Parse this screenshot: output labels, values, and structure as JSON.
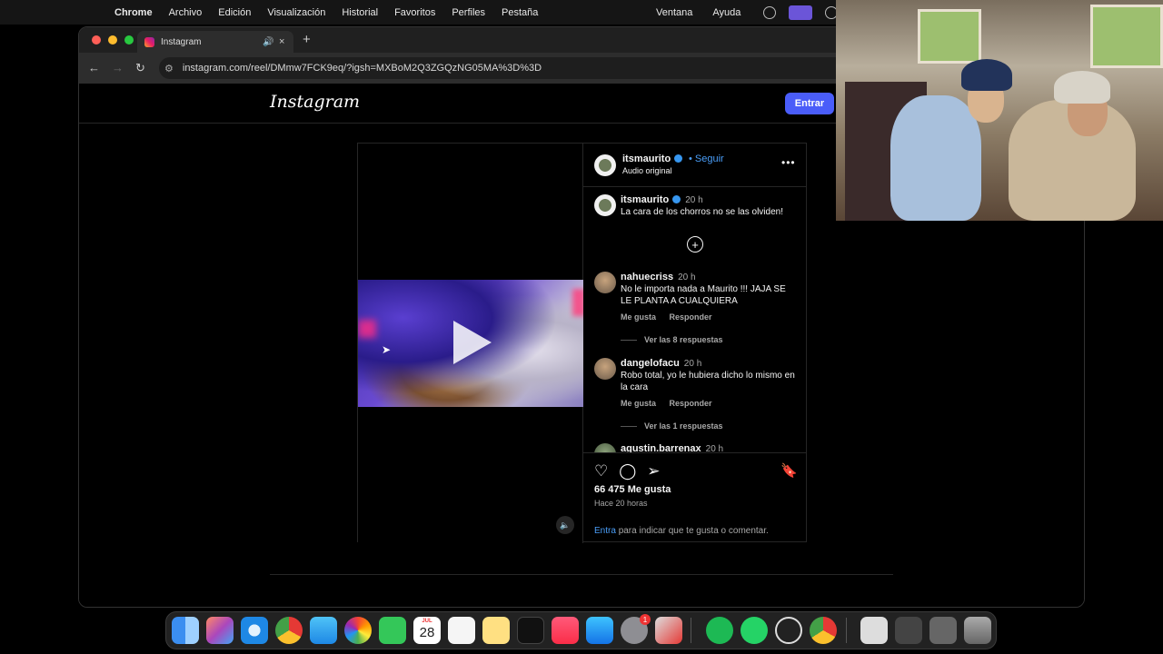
{
  "menubar": {
    "app": "Chrome",
    "items": [
      "Archivo",
      "Edición",
      "Visualización",
      "Historial",
      "Favoritos",
      "Perfiles",
      "Pestaña"
    ],
    "right_items": [
      "Ventana",
      "Ayuda"
    ]
  },
  "browser": {
    "tab_title": "Instagram",
    "url": "instagram.com/reel/DMmw7FCK9eq/?igsh=MXBoM2Q3ZGQzNG05MA%3D%3D",
    "new_tab": "+",
    "close_tab": "×"
  },
  "instagram": {
    "logo": "Instagram",
    "login_button": "Entrar",
    "post": {
      "author": "itsmaurito",
      "follow": "Seguir",
      "audio": "Audio original",
      "more": "•••",
      "caption_author": "itsmaurito",
      "caption_time": "20 h",
      "caption": "La cara de los chorros no se las olviden!",
      "plus": "+",
      "comments": [
        {
          "user": "nahuecriss",
          "time": "20 h",
          "text": "No le importa nada a Maurito !!! JAJA SE LE PLANTA A CUALQUIERA",
          "like": "Me gusta",
          "reply": "Responder",
          "view_replies": "Ver las 8 respuestas"
        },
        {
          "user": "dangelofacu",
          "time": "20 h",
          "text": "Robo total, yo le hubiera dicho lo mismo en la cara",
          "like": "Me gusta",
          "reply": "Responder",
          "view_replies": "Ver las 1 respuestas"
        },
        {
          "user": "agustin.barrenax",
          "time": "20 h"
        }
      ],
      "likes": "66 475 Me gusta",
      "posted_ago": "Hace 20 horas",
      "login_link": "Entra",
      "login_prompt": "para indicar que te gusta o comentar."
    }
  },
  "dock": {
    "calendar_month": "JUL",
    "calendar_day": "28",
    "settings_badge": "1"
  },
  "colors": {
    "accent": "#4a5df9",
    "link": "#4a9ef8",
    "background": "#000000"
  }
}
